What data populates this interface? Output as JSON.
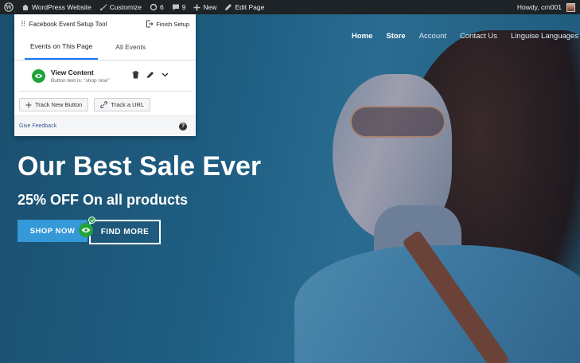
{
  "admin_bar": {
    "site_name": "WordPress Website",
    "customize": "Customize",
    "updates_count": "6",
    "comments_count": "9",
    "new_label": "New",
    "edit_page": "Edit Page",
    "howdy": "Howdy, crn001"
  },
  "nav": {
    "items": [
      "Home",
      "Store",
      "Account",
      "Contact Us",
      "Linguise Languages"
    ],
    "active": "Home"
  },
  "hero": {
    "headline": "Our Best Sale Ever",
    "subline": "25% OFF On all products",
    "shop_button": "SHOP NOW",
    "find_button": "FIND MORE"
  },
  "panel": {
    "title": "Facebook Event Setup Tool",
    "finish": "Finish Setup",
    "tabs": [
      "Events on This Page",
      "All Events"
    ],
    "event": {
      "name": "View Content",
      "subtitle": "Button text is: \"shop now\""
    },
    "track_button": "Track New Button",
    "track_url": "Track a URL",
    "feedback": "Give Feedback",
    "help": "?"
  },
  "colors": {
    "admin_bar_bg": "#1d2327",
    "accent_green": "#21a33b",
    "shop_button": "#3598d8",
    "tab_underline": "#1877f2"
  }
}
